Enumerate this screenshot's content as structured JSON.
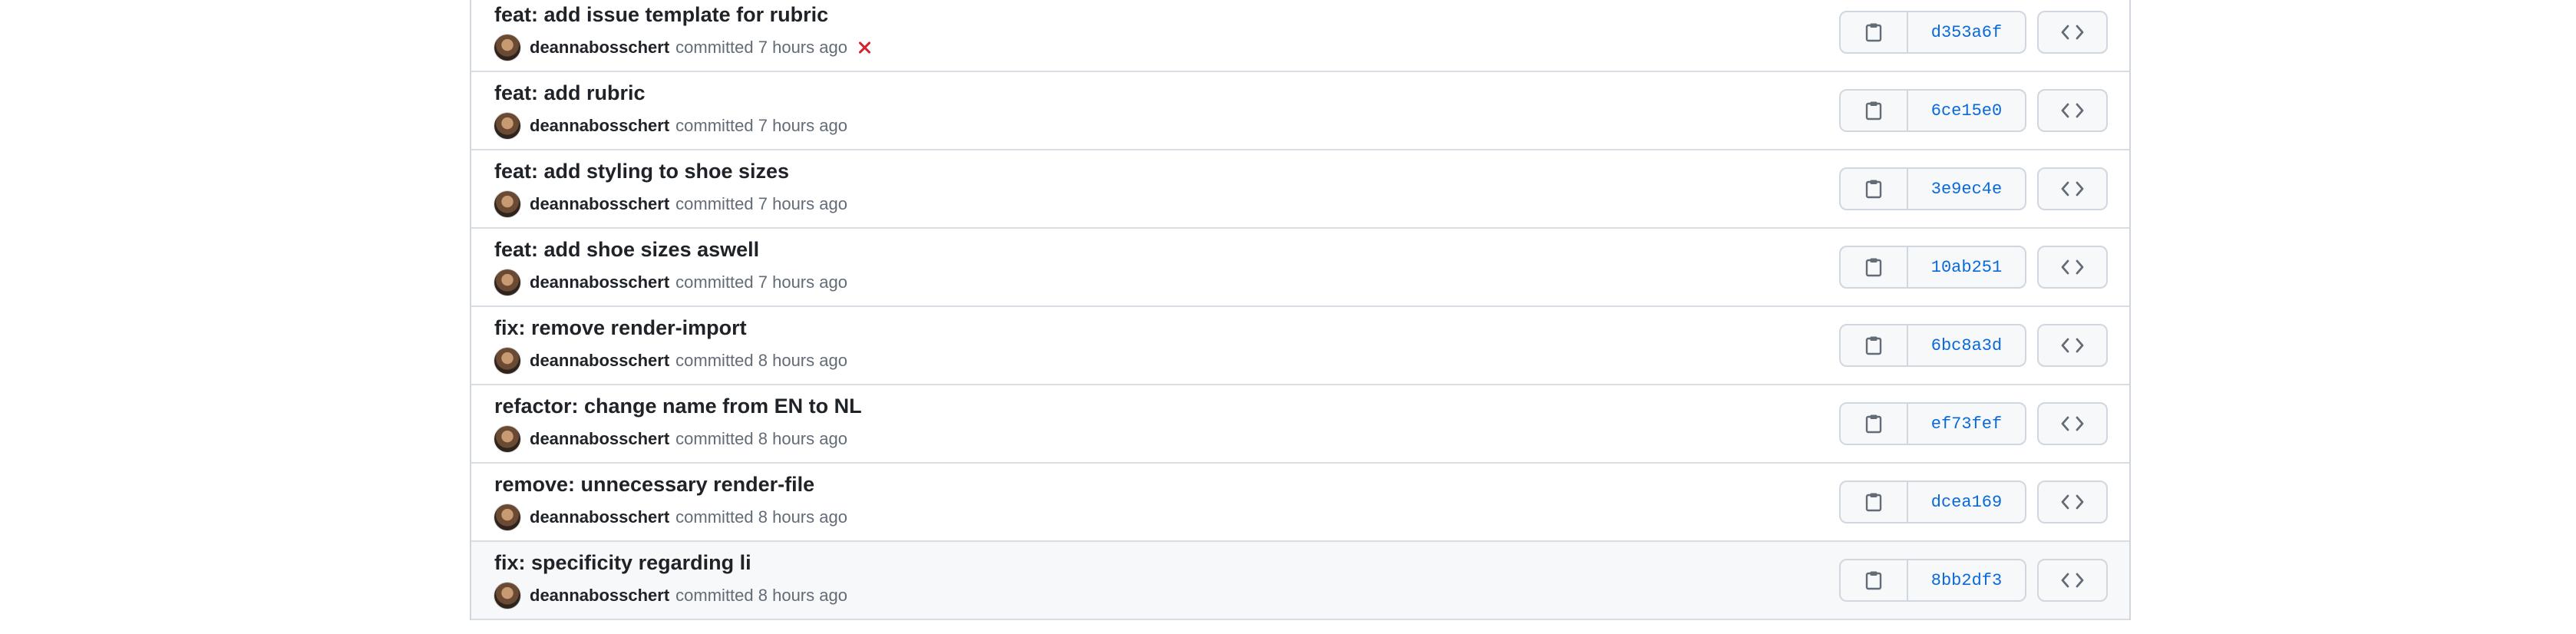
{
  "commits": [
    {
      "title": "feat: add issue template for rubric",
      "author": "deannabosschert",
      "time": "committed 7 hours ago",
      "sha": "d353a6f",
      "status": "failed"
    },
    {
      "title": "feat: add rubric",
      "author": "deannabosschert",
      "time": "committed 7 hours ago",
      "sha": "6ce15e0"
    },
    {
      "title": "feat: add styling to shoe sizes",
      "author": "deannabosschert",
      "time": "committed 7 hours ago",
      "sha": "3e9ec4e"
    },
    {
      "title": "feat: add shoe sizes aswell",
      "author": "deannabosschert",
      "time": "committed 7 hours ago",
      "sha": "10ab251"
    },
    {
      "title": "fix: remove render-import",
      "author": "deannabosschert",
      "time": "committed 8 hours ago",
      "sha": "6bc8a3d"
    },
    {
      "title": "refactor: change name from EN to NL",
      "author": "deannabosschert",
      "time": "committed 8 hours ago",
      "sha": "ef73fef"
    },
    {
      "title": "remove: unnecessary render-file",
      "author": "deannabosschert",
      "time": "committed 8 hours ago",
      "sha": "dcea169"
    },
    {
      "title": "fix: specificity regarding li",
      "author": "deannabosschert",
      "time": "committed 8 hours ago",
      "sha": "8bb2df3"
    }
  ],
  "icons": {
    "copy": "clipboard-icon",
    "browse": "code-icon",
    "status_failed": "x-icon"
  },
  "colors": {
    "link": "#0969da",
    "failed": "#d1242f",
    "border": "#d0d7de"
  }
}
